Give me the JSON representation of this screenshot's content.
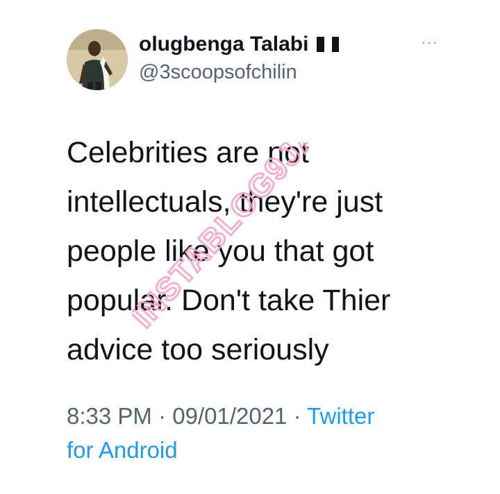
{
  "user": {
    "display_name": "olugbenga Talabi",
    "flag_icon": "nigeria-flag-icon",
    "handle": "@3scoopsofchilin",
    "more_icon": "more-options-icon",
    "more_label": "···"
  },
  "tweet": {
    "lines": [
      "Celebrities are not",
      "intellectuals, they're just",
      "people like you that got",
      "popular. Don't take Thier",
      "advice too seriously"
    ]
  },
  "watermark": {
    "text": "INSTABLOG9JA"
  },
  "meta": {
    "time": "8:33 PM",
    "separator": "·",
    "date": "09/01/2021",
    "source_line1": "Twitter",
    "source_line2": "for Android"
  },
  "colors": {
    "link": "#1d9bf0",
    "secondary": "#536471",
    "primary_text": "#0f1419",
    "flag_green": "#008751",
    "watermark_pink": "#f5a6c8"
  }
}
